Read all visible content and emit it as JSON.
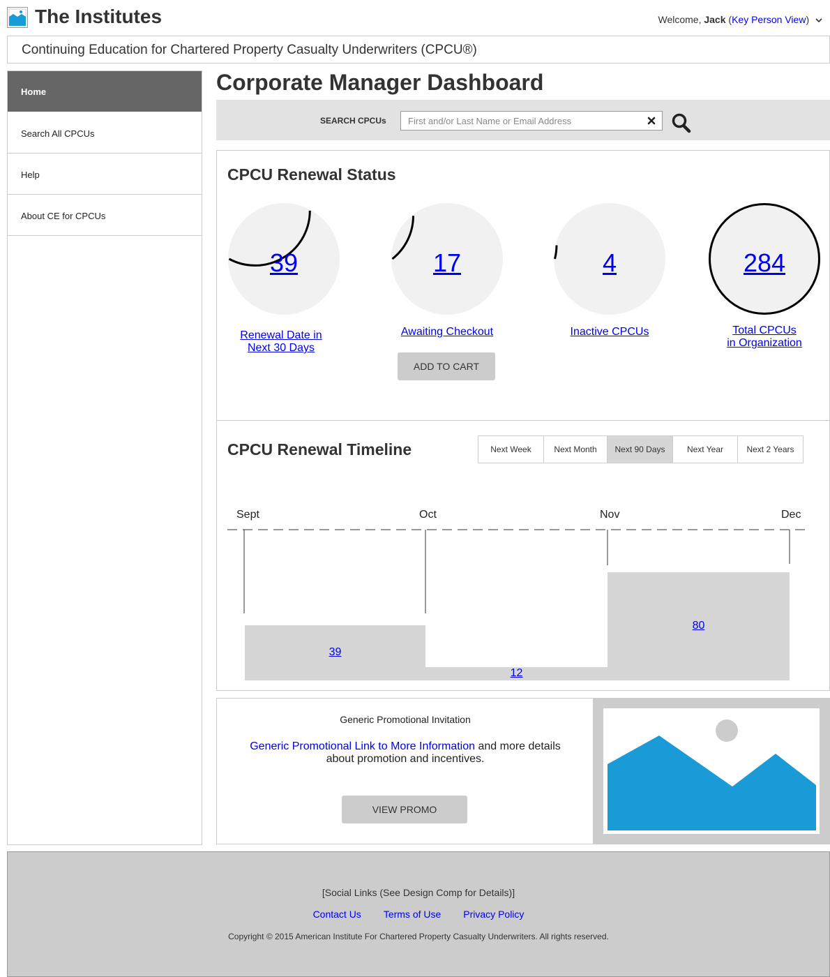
{
  "header": {
    "app_title": "The Institutes",
    "welcome_prefix": "Welcome, ",
    "user_name": "Jack",
    "role_link": "Key Person View",
    "subtitle": "Continuing Education for Chartered Property Casualty Underwriters (CPCU®)"
  },
  "sidebar": {
    "items": [
      {
        "label": "Home",
        "active": true
      },
      {
        "label": "Search All CPCUs",
        "active": false
      },
      {
        "label": "Help",
        "active": false
      },
      {
        "label": "About CE for CPCUs",
        "active": false
      }
    ]
  },
  "main": {
    "page_title": "Corporate Manager Dashboard",
    "search": {
      "label": "SEARCH CPCUs",
      "placeholder": "First and/or Last Name or Email Address",
      "value": ""
    },
    "renewal_status": {
      "title": "CPCU Renewal Status",
      "gauges": [
        {
          "value": "39",
          "label_line1": "Renewal Date in",
          "label_line2": "Next 30 Days",
          "fraction": 0.137
        },
        {
          "value": "17",
          "label_line1": "Awaiting Checkout",
          "label_line2": "",
          "fraction": 0.06
        },
        {
          "value": "4",
          "label_line1": "Inactive CPCUs",
          "label_line2": "",
          "fraction": 0.014
        },
        {
          "value": "284",
          "label_line1": "Total CPCUs",
          "label_line2": "in Organization",
          "fraction": 1.0
        }
      ],
      "add_to_cart_label": "ADD TO CART"
    },
    "timeline": {
      "title": "CPCU Renewal Timeline",
      "ranges": [
        "Next Week",
        "Next Month",
        "Next 90 Days",
        "Next Year",
        "Next 2 Years"
      ],
      "selected_range": "Next 90 Days",
      "months": [
        "Sept",
        "Oct",
        "Nov",
        "Dec"
      ],
      "bars": [
        "39",
        "12",
        "80"
      ]
    },
    "promo": {
      "title": "Generic Promotional Invitation",
      "link_text": "Generic Promotional Link to More Information",
      "body_text": " and more details about promotion and incentives.",
      "button_label": "VIEW PROMO",
      "image_icon": "image-placeholder-icon"
    }
  },
  "footer": {
    "social": "[Social Links (See Design Comp for Details)]",
    "links": [
      "Contact Us",
      "Terms of Use",
      "Privacy Policy"
    ],
    "copyright": "Copyright © 2015 American Institute For Chartered Property Casualty Underwriters. All rights reserved."
  },
  "colors": {
    "accent_blue": "#1a9ad6",
    "link": "#0000ee",
    "active_nav": "#666666",
    "panel_grey": "#e2e2e2",
    "bar_grey": "#d6d6d6"
  }
}
